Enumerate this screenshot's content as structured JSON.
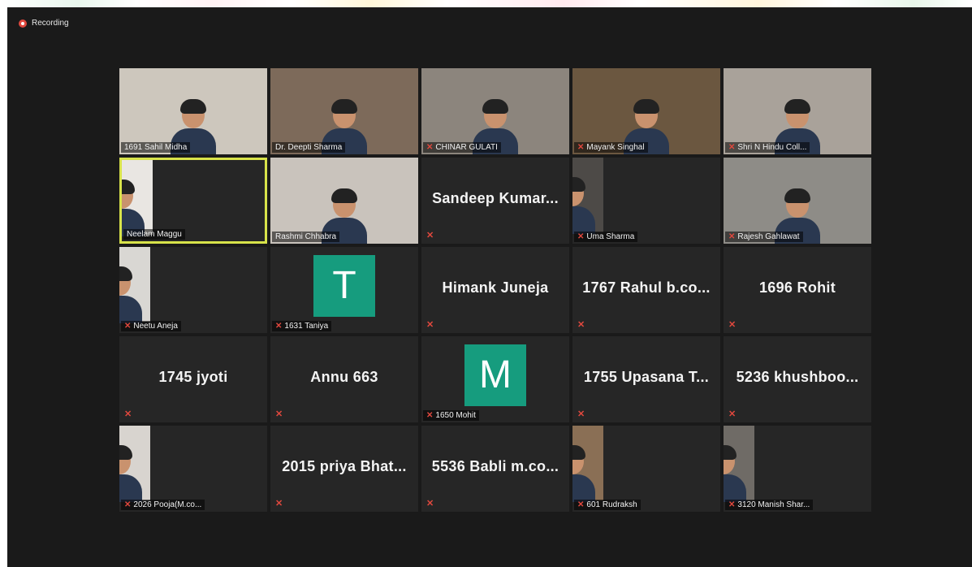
{
  "recording": {
    "label": "Recording"
  },
  "participants": [
    {
      "name": "1691 Sahil Midha",
      "type": "video",
      "bg": "#cdc7bd",
      "muted": false
    },
    {
      "name": "Dr. Deepti Sharma",
      "type": "video",
      "bg": "#7d6a5a",
      "muted": false
    },
    {
      "name": "CHINAR GULATI",
      "type": "video",
      "bg": "#8c857d",
      "muted": true
    },
    {
      "name": "Mayank Singhal",
      "type": "video",
      "bg": "#6b5740",
      "muted": true
    },
    {
      "name": "Shri N Hindu Coll...",
      "type": "video",
      "bg": "#a9a29a",
      "muted": true
    },
    {
      "name": "Neelam Maggu",
      "type": "video-small",
      "bg": "#e9e6e2",
      "muted": false,
      "active": true
    },
    {
      "name": "Rashmi Chhabra",
      "type": "video",
      "bg": "#c9c3bc",
      "muted": false
    },
    {
      "name": "Sandeep  Kumar...",
      "type": "name",
      "muted": true
    },
    {
      "name": "Uma Sharma",
      "type": "video-small",
      "bg": "#4d4a47",
      "muted": true
    },
    {
      "name": "Rajesh Gahlawat",
      "type": "video",
      "bg": "#8e8c87",
      "muted": true
    },
    {
      "name": "Neetu Aneja",
      "type": "video-small",
      "bg": "#d9d7d3",
      "muted": true
    },
    {
      "name": "1631 Taniya",
      "type": "letter",
      "letter": "T",
      "muted": true
    },
    {
      "name": "Himank Juneja",
      "type": "name",
      "muted": true
    },
    {
      "name": "1767  Rahul  b.co...",
      "type": "name",
      "muted": true
    },
    {
      "name": "1696 Rohit",
      "type": "name",
      "muted": true
    },
    {
      "name": "1745 jyoti",
      "type": "name",
      "muted": true
    },
    {
      "name": "Annu 663",
      "type": "name",
      "muted": true
    },
    {
      "name": "1650 Mohit",
      "type": "letter",
      "letter": "M",
      "muted": true
    },
    {
      "name": "1755  Upasana  T...",
      "type": "name",
      "muted": true
    },
    {
      "name": "5236  khushboo...",
      "type": "name",
      "muted": true
    },
    {
      "name": "2026 Pooja(M.co...",
      "type": "video-small",
      "bg": "#d8d4cf",
      "muted": true
    },
    {
      "name": "2015  priya  Bhat...",
      "type": "name",
      "muted": true
    },
    {
      "name": "5536  Babli  m.co...",
      "type": "name",
      "muted": true
    },
    {
      "name": "601 Rudraksh",
      "type": "video-small",
      "bg": "#8a6f55",
      "muted": true
    },
    {
      "name": "3120 Manish Shar...",
      "type": "video-small",
      "bg": "#6f6b66",
      "muted": true
    }
  ]
}
